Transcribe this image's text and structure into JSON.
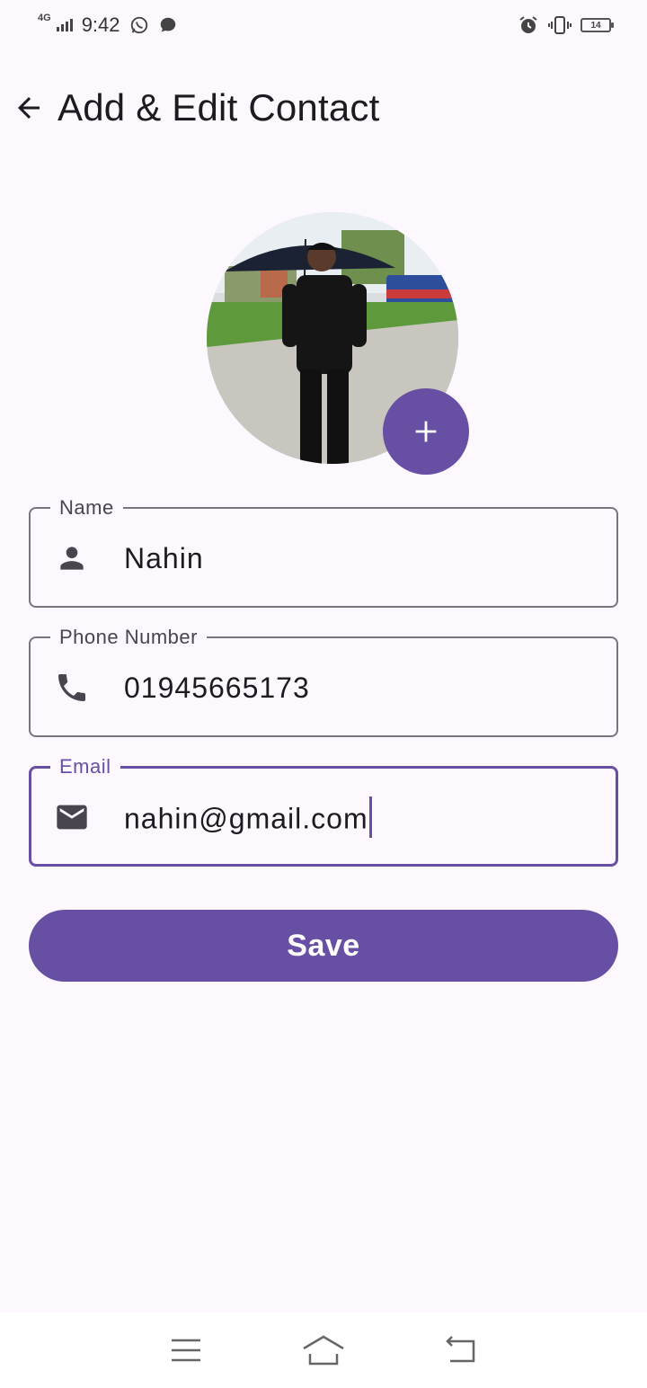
{
  "status_bar": {
    "network": "4G",
    "time": "9:42",
    "battery": "14"
  },
  "app_bar": {
    "title": "Add & Edit Contact"
  },
  "form": {
    "name": {
      "label": "Name",
      "value": "Nahin",
      "icon": "person-icon"
    },
    "phone": {
      "label": "Phone Number",
      "value": "01945665173",
      "icon": "phone-icon"
    },
    "email": {
      "label": "Email",
      "value": "nahin@gmail.com",
      "icon": "mail-icon"
    }
  },
  "save_button": {
    "label": "Save"
  },
  "colors": {
    "primary": "#6750a4",
    "background": "#fdf7fe",
    "outline": "#79747e",
    "on_surface": "#1d1b20"
  }
}
